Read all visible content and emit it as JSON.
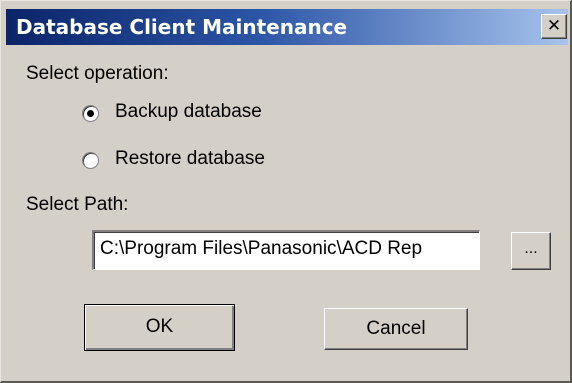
{
  "window": {
    "title": "Database Client Maintenance",
    "close_glyph": "✕"
  },
  "operation": {
    "label": "Select operation:",
    "options": [
      {
        "label": "Backup database",
        "selected": true
      },
      {
        "label": "Restore database",
        "selected": false
      }
    ]
  },
  "path": {
    "label": "Select Path:",
    "value": "C:\\Program Files\\Panasonic\\ACD Rep",
    "browse_label": "..."
  },
  "buttons": {
    "ok_label": "OK",
    "cancel_label": "Cancel"
  },
  "colors": {
    "face": "#d4d0c8",
    "title_start": "#0b2468",
    "title_end": "#a7c3ec"
  }
}
